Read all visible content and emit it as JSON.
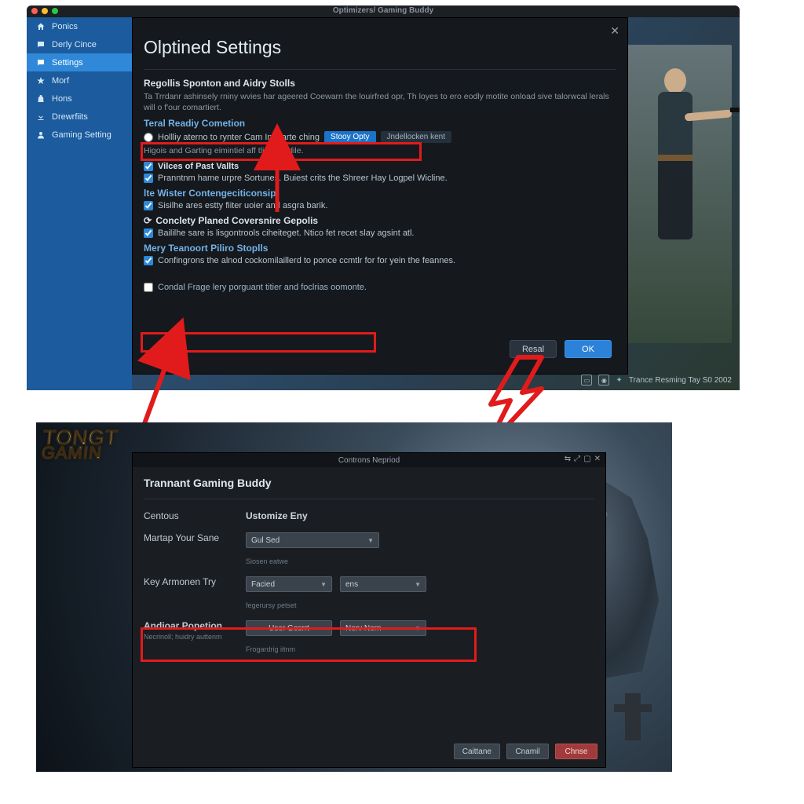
{
  "top": {
    "title": "Optimizers/ Gaming Buddy",
    "sidebar": {
      "items": [
        {
          "icon": "home",
          "label": "Ponics"
        },
        {
          "icon": "chat",
          "label": "Derly Cince"
        },
        {
          "icon": "chat",
          "label": "Settings"
        },
        {
          "icon": "star",
          "label": "Morf"
        },
        {
          "icon": "bag",
          "label": "Hons"
        },
        {
          "icon": "download",
          "label": "Drewrfiits"
        },
        {
          "icon": "user",
          "label": "Gaming Setting"
        }
      ]
    },
    "dialog": {
      "title": "Olptined Settings",
      "s1_h": "Regollis Sponton and Aidry Stolls",
      "s1_p": "Ta Trrdanr ashinsely rniny wvies har ageered Coewarn the louirfred opr, Th loyes to ero eodly motite onload sive talorwcal lerals will o f'our comartiert.",
      "s2_h": "Teral Readiy Cometion",
      "s2_radio": "Hollliy aterno to rynter Cam In Marte ching",
      "s2_pill_a": "Stooy Opty",
      "s2_pill_b": "Jndellocken kent",
      "s2_sub": "Higois and Garting eimintiel aff tliny Cordile.",
      "c1": "Vilces of Past Vallts",
      "c2": "Pranntnm hame urpre Sortunes. Buiest crits the Shreer Hay Logpel Wicline.",
      "s3_h": "lte Wister Contengeciticonsip",
      "c3": "Sisilhe ares estty fiiter uoier and asgra barik.",
      "s4_h": "Conclety Planed Coversnire Gepolis",
      "c4": "Baililhe sare is lisgontrools ciheiteget. Ntico fet recet slay agsint atl.",
      "s5_h": "Mery Teanoort Piliro Stoplls",
      "c5": "Confingrons the alnod cockomilaillerd to ponce ccmtlr for for yein the feannes.",
      "c6": "Condal Frage lery porguant titier and foclrias oomonte.",
      "btn_reset": "Resal",
      "btn_ok": "OK"
    },
    "status": "Trance Resming Tay S0 2002"
  },
  "bottom": {
    "logo1": "TONGT",
    "logo2": "GAMIN",
    "win": {
      "title": "Controns Nepriod",
      "heading": "Trannant Gaming Buddy",
      "rows": {
        "r1_label": "Centous",
        "r1_value": "Ustomize Eny",
        "r2_label": "Martap Your Sane",
        "r2_select": "Gul Sed",
        "r2_sub": "Siosen eatwe",
        "r3_label": "Key Armonen Try",
        "r3_sel_a": "Facied",
        "r3_sel_b": "ens",
        "r3_sub": "fegerursy petset",
        "r4_label": "Andioar Popetion",
        "r4_sub_label": "Necrinoll; huidry auttenm",
        "r4_btn": "User Gesrrt",
        "r4_sel": "Nerv Norn",
        "r4_sub": "Frogardrig iitnm"
      },
      "btn_a": "Caittane",
      "btn_b": "Cnamil",
      "btn_c": "Chnse"
    }
  }
}
